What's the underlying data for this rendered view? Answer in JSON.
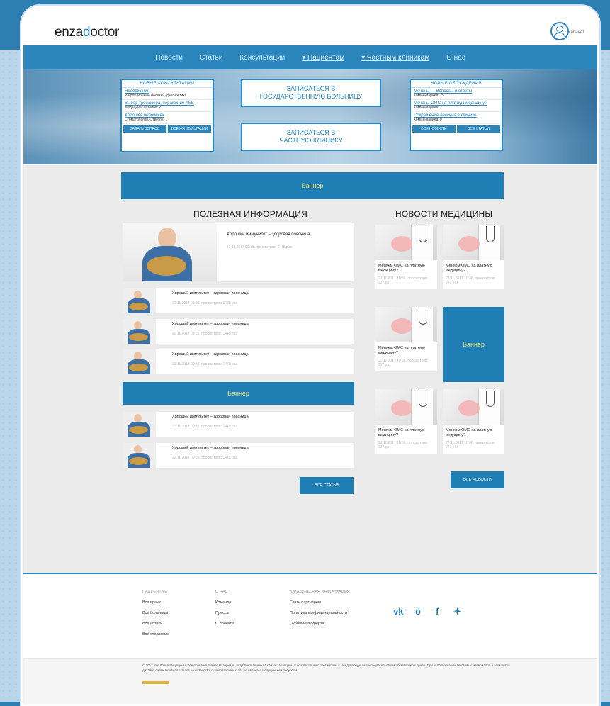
{
  "brand": {
    "logo_prefix": "enza",
    "logo_accent": "d",
    "logo_suffix": "octor",
    "profile_label": "кабинет"
  },
  "nav": [
    "Новости",
    "Статьи",
    "Консультации",
    "▾ Пациентам",
    "▾ Частным клиникам",
    "О нас"
  ],
  "consultations": {
    "title": "НОВЫЕ КОНСУЛЬТАЦИИ",
    "items": [
      {
        "title": "Недержание",
        "sub": "Инфекционные болезни, диагностика"
      },
      {
        "title": "Выбор тренажера, поражение ЛЁВ",
        "sub": "Медицина. Ответов: 2"
      },
      {
        "title": "Хорошее человечек",
        "sub": "Стоматология. Ответов: 1"
      }
    ],
    "btn_ask": "ЗАДАТЬ ВОПРОС",
    "btn_all": "ВСЕ КОНСУЛЬТАЦИИ"
  },
  "hero_buttons": {
    "state": [
      "ЗАПИСАТЬСЯ В",
      "ГОСУДАРСТВЕННУЮ БОЛЬНИЦУ"
    ],
    "private": [
      "ЗАПИСАТЬСЯ В",
      "ЧАСТНУЮ КЛИНИКУ"
    ]
  },
  "discussions": {
    "title": "НОВЫЕ ОБСУЖДЕНИЯ",
    "items": [
      {
        "title": "Мечены — Вопросы и ответы",
        "sub": "Комментариев: 29"
      },
      {
        "title": "Мечены ОМС на платную медицину?",
        "sub": "Комментариев: 2"
      },
      {
        "title": "Сокращение лечения в клинике",
        "sub": "Комментариев: 0"
      }
    ],
    "btn_news": "ВСЕ НОВОСТИ",
    "btn_articles": "ВСЕ СТАТЬИ"
  },
  "banner_label": "Баннер",
  "useful": {
    "title": "ПОЛЕЗНАЯ ИНФОРМАЦИЯ",
    "featured": {
      "title": "Хороший иммунитет – здоровая поясница",
      "meta": "22.11.2017 09:38, просмотров: 1445 раз"
    },
    "articles": [
      {
        "title": "Хороший иммунитет – здоровая поясница",
        "meta": "22.11.2017 09:38, просмотров: 1445 раз"
      },
      {
        "title": "Хороший иммунитет – здоровая поясница",
        "meta": "22.11.2017 09:38, просмотров: 1445 раз"
      },
      {
        "title": "Хороший иммунитет – здоровая поясница",
        "meta": "22.11.2017 09:38, просмотров: 1445 раз"
      },
      {
        "title": "Хороший иммунитет – здоровая поясница",
        "meta": "22.11.2017 09:38, просмотров: 1445 раз"
      },
      {
        "title": "Хороший иммунитет – здоровая поясница",
        "meta": "22.11.2017 09:38, просмотров: 1445 раз"
      }
    ],
    "all_button": "ВСЕ СТАТЬИ"
  },
  "news": {
    "title": "НОВОСТИ МЕДИЦИНЫ",
    "items": [
      {
        "title": "Меняем ОМС на платную медицину?",
        "meta": "22.11.2017 10:36, просмотров: 227 раз"
      },
      {
        "title": "Меняем ОМС на платную медицину?",
        "meta": "22.11.2017 10:36, просмотров: 227 раз"
      },
      {
        "title": "Меняем ОМС на платную медицину?",
        "meta": "22.11.2017 10:36, просмотров: 227 раз"
      },
      {
        "title": "Меняем ОМС на платную медицину?",
        "meta": "22.11.2017 10:36, просмотров: 227 раз"
      },
      {
        "title": "Меняем ОМС на платную медицину?",
        "meta": "22.11.2017 10:36, просмотров: 227 раз"
      }
    ],
    "all_button": "ВСЕ НОВОСТИ"
  },
  "footer": {
    "col1": {
      "heading": "ПАЦИЕНТАМ",
      "links": [
        "Все врачи",
        "Все больницы",
        "Все аптеки",
        "Все страховые"
      ]
    },
    "col2": {
      "heading": "О НАС",
      "links": [
        "Команда",
        "Пресса",
        "О проекте"
      ]
    },
    "col3": {
      "heading": "ЮРИДИЧЕСКАЯ ИНФОРМАЦИЯ",
      "links": [
        "Стать партнёром",
        "Политика конфиденциальности",
        "Публичная оферта"
      ]
    },
    "social": [
      "vk-icon",
      "odnoklassniki-icon",
      "facebook-icon",
      "twitter-icon"
    ],
    "copyright": "© 2017 Все права защищены. Все права на любые материалы, опубликованные на сайте, защищены в соответствии с российским и международным законодательством об авторском праве. При использовании текстовых материалов и элементов дизайна сайта активная ссылка на enzadoctor.ru обязательна. Сайт не является медицинским ресурсом."
  },
  "colors": {
    "brand": "#2a86bd",
    "banner": "#1f7fb4",
    "banner_text": "#f2e27b"
  }
}
